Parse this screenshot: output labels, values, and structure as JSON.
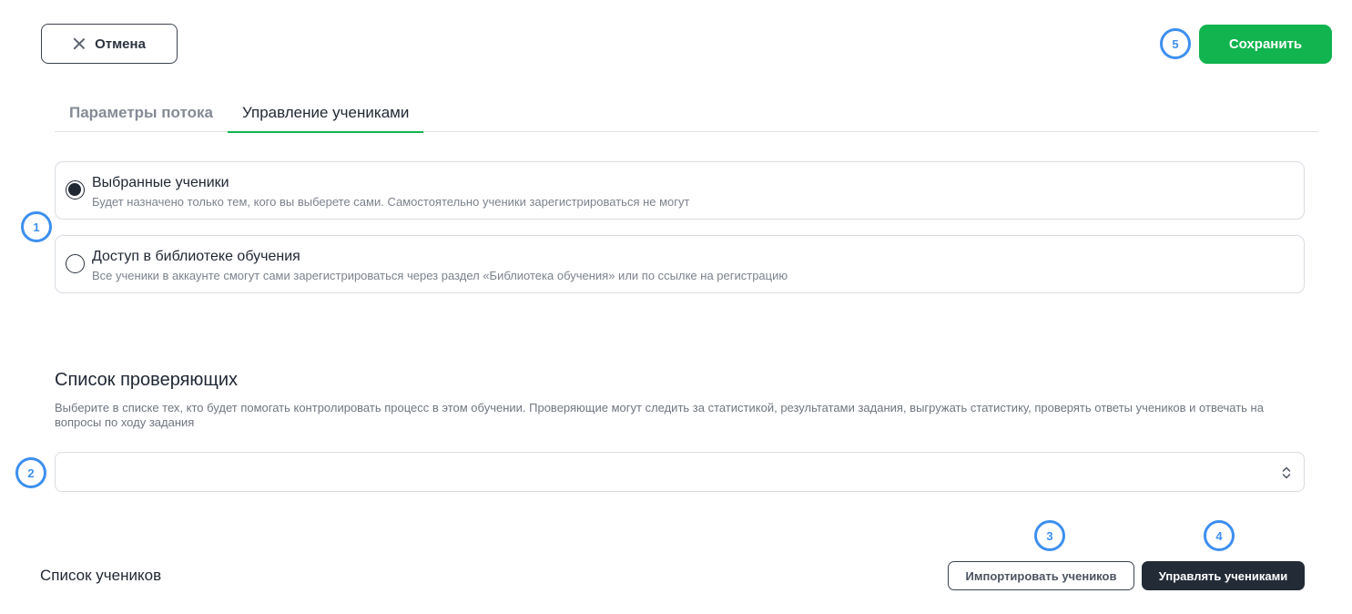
{
  "header": {
    "cancel_label": "Отмена",
    "save_label": "Сохранить"
  },
  "tabs": [
    {
      "label": "Параметры потока",
      "active": false
    },
    {
      "label": "Управление учениками",
      "active": true
    }
  ],
  "access": {
    "options": [
      {
        "title": "Выбранные ученики",
        "description": "Будет назначено только тем, кого вы выберете сами. Самостоятельно ученики зарегистрироваться не могут",
        "selected": true
      },
      {
        "title": "Доступ в библиотеке обучения",
        "description": "Все ученики в аккаунте смогут сами зарегистрироваться через раздел «Библиотека обучения» или по ссылке на регистрацию",
        "selected": false
      }
    ]
  },
  "reviewers": {
    "title": "Список проверяющих",
    "description": "Выберите в списке тех, кто будет помогать контролировать процесс в этом обучении. Проверяющие могут следить за статистикой, результатами задания, выгружать статистику, проверять ответы учеников и отвечать на вопросы по ходу задания",
    "select_value": ""
  },
  "students": {
    "title": "Список учеников",
    "import_label": "Импортировать учеников",
    "manage_label": "Управлять учениками"
  },
  "markers": [
    "1",
    "2",
    "3",
    "4",
    "5"
  ],
  "colors": {
    "accent_green": "#11b44e",
    "marker_blue": "#3d8fef",
    "dark_button": "#232b37"
  }
}
